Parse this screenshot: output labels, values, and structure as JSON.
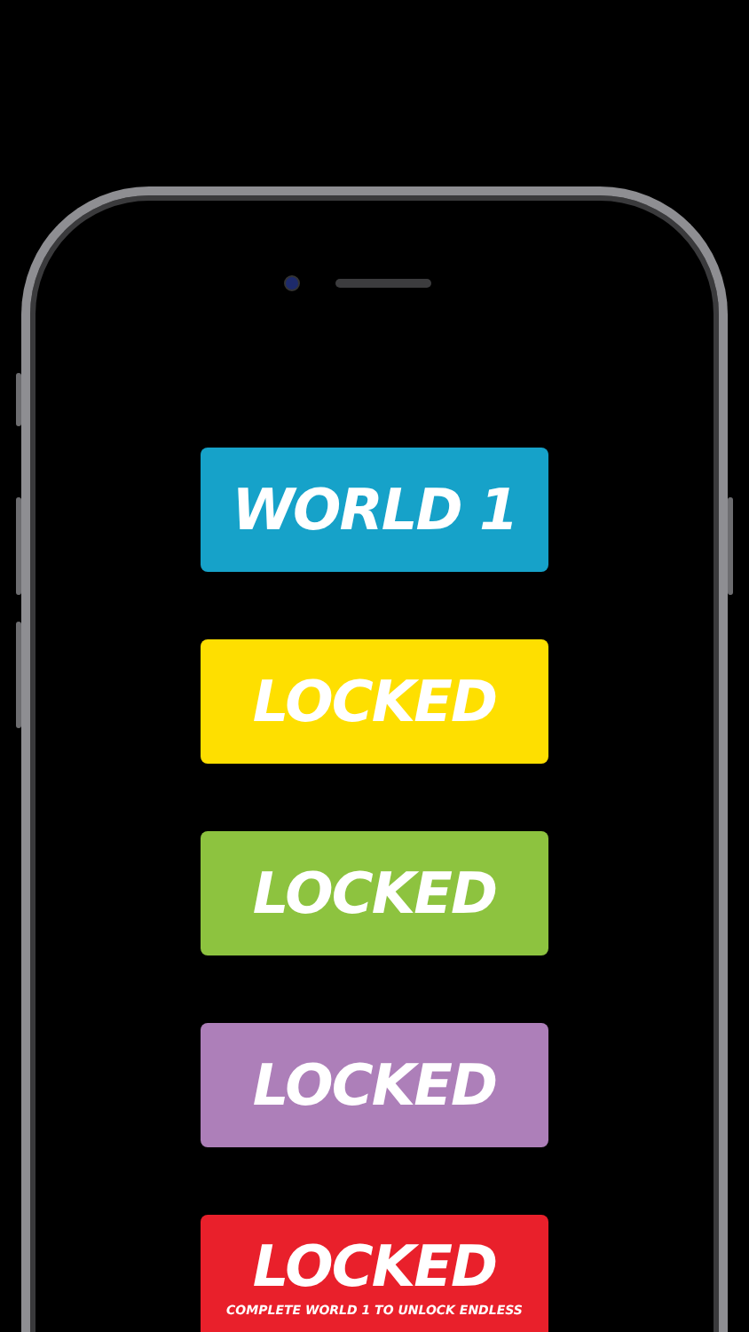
{
  "worlds": [
    {
      "label": "WORLD 1",
      "color": "#16a2c9"
    },
    {
      "label": "LOCKED",
      "color": "#fedf00"
    },
    {
      "label": "LOCKED",
      "color": "#8dc33f"
    },
    {
      "label": "LOCKED",
      "color": "#ad7fb9"
    },
    {
      "label": "LOCKED",
      "color": "#e9202b",
      "note": "COMPLETE WORLD 1 TO UNLOCK ENDLESS"
    }
  ]
}
